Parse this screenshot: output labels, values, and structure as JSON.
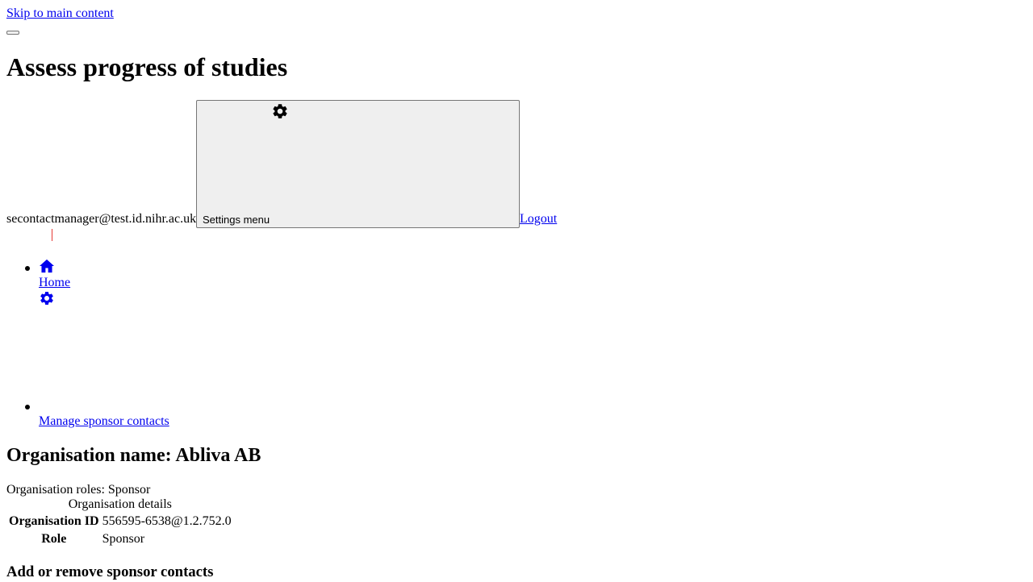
{
  "skip_link": "Skip to main content",
  "page_title": "Assess progress of studies",
  "header": {
    "user_email": "secontactmanager@test.id.nihr.ac.uk",
    "settings_menu_label": "Settings menu",
    "logout_label": "Logout"
  },
  "nav": {
    "items": [
      {
        "label": "Home",
        "icon": "home-icon"
      },
      {
        "label": "Manage sponsor contacts",
        "icon": "gear-icon"
      }
    ]
  },
  "organisation": {
    "heading": "Organisation name: Abliva AB",
    "roles_line": "Organisation roles: Sponsor",
    "details_caption": "Organisation details",
    "rows": [
      {
        "header": "Organisation ID",
        "value": "556595-6538@1.2.752.0"
      },
      {
        "header": "Role",
        "value": "Sponsor"
      }
    ]
  },
  "contacts_heading": "Add or remove sponsor contacts",
  "colors": {
    "link": "#0000ee",
    "button_bg": "#efefef",
    "button_border": "#767676",
    "accent_red": "#e53935"
  }
}
